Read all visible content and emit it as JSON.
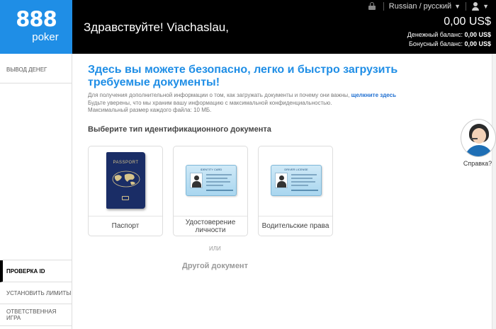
{
  "header": {
    "logo_number": "888",
    "logo_word": "poker",
    "greeting": "Здравствуйте! Viachaslau,",
    "language": "Russian / русский",
    "balance_main": "0,00 US$",
    "cash_balance_label": "Денежный баланс:",
    "cash_balance_value": "0,00 US$",
    "bonus_balance_label": "Бонусный баланс:",
    "bonus_balance_value": "0,00 US$"
  },
  "sidebar": {
    "items": [
      {
        "label": "ВЫВОД ДЕНЕГ"
      },
      {
        "label": "ПРОВЕРКА ID"
      },
      {
        "label": "УСТАНОВИТЬ ЛИМИТЫ"
      },
      {
        "label": "ОТВЕТСТВЕННАЯ ИГРА"
      }
    ]
  },
  "main": {
    "title": "Здесь вы можете безопасно, легко и быстро загрузить требуемые документы!",
    "info_line1": "Для получения дополнительной информации о том, как загружать документы и почему они важны,",
    "info_link": "щелкните здесь",
    "info_line2": "Будьте уверены, что мы храним вашу информацию с максимальной конфиденциальностью.",
    "info_line3": "Максимальный размер каждого файла: 10 МБ.",
    "choose_label": "Выберите тип идентификационного документа",
    "cards": [
      {
        "label": "Паспорт",
        "cover_text": "PASSPORT"
      },
      {
        "label": "Удостоверение личности",
        "card_title": "IDENTITY CARD"
      },
      {
        "label": "Водительские права",
        "card_title": "DRIVER LICENSE"
      }
    ],
    "or_text": "ИЛИ",
    "other_doc": "Другой документ"
  },
  "help": {
    "label": "Справка?"
  },
  "colors": {
    "accent": "#1f8ee6",
    "header_bg": "#000000",
    "passport_blue": "#1a2d66"
  }
}
